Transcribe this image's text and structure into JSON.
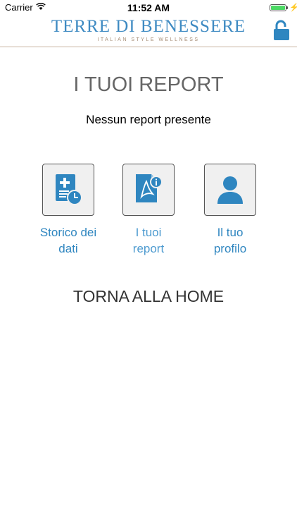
{
  "status_bar": {
    "carrier": "Carrier",
    "time": "11:52 AM",
    "battery_level": 1.0
  },
  "header": {
    "brand_title": "TERRE DI BENESSERE",
    "brand_subtitle": "ITALIAN STYLE WELLNESS",
    "lock_icon": "unlocked-padlock-icon",
    "brand_color": "#3e8ac2"
  },
  "main": {
    "title": "I TUOI REPORT",
    "empty_message": "Nessun report presente",
    "tiles": [
      {
        "line1": "Storico dei",
        "line2": "dati",
        "icon": "document-history-icon"
      },
      {
        "line1": "I tuoi",
        "line2": "report",
        "icon": "pdf-report-icon"
      },
      {
        "line1": "Il tuo",
        "line2": "profilo",
        "icon": "user-profile-icon"
      }
    ],
    "home_link": "TORNA ALLA HOME"
  },
  "colors": {
    "accent": "#2f86c0",
    "tile_background": "#f0f0f0"
  }
}
